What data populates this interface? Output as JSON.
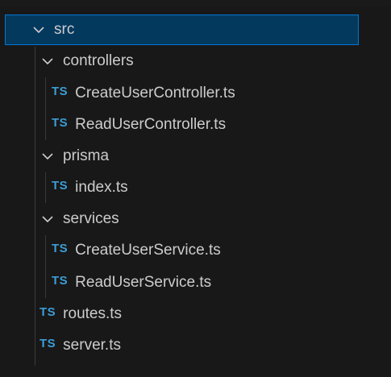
{
  "explorer": {
    "tree": [
      {
        "type": "folder",
        "label": "src",
        "depth": 0,
        "expanded": true,
        "selected": true,
        "icon": "chevron-down-icon"
      },
      {
        "type": "folder",
        "label": "controllers",
        "depth": 1,
        "expanded": true,
        "icon": "chevron-down-icon"
      },
      {
        "type": "file",
        "label": "CreateUserController.ts",
        "depth": 2,
        "badge": "TS"
      },
      {
        "type": "file",
        "label": "ReadUserController.ts",
        "depth": 2,
        "badge": "TS"
      },
      {
        "type": "folder",
        "label": "prisma",
        "depth": 1,
        "expanded": true,
        "icon": "chevron-down-icon"
      },
      {
        "type": "file",
        "label": "index.ts",
        "depth": 2,
        "badge": "TS"
      },
      {
        "type": "folder",
        "label": "services",
        "depth": 1,
        "expanded": true,
        "icon": "chevron-down-icon"
      },
      {
        "type": "file",
        "label": "CreateUserService.ts",
        "depth": 2,
        "badge": "TS"
      },
      {
        "type": "file",
        "label": "ReadUserService.ts",
        "depth": 2,
        "badge": "TS"
      },
      {
        "type": "file",
        "label": "routes.ts",
        "depth": 1,
        "badge": "TS"
      },
      {
        "type": "file",
        "label": "server.ts",
        "depth": 1,
        "badge": "TS"
      }
    ]
  },
  "colors": {
    "background": "#181818",
    "selection_bg": "#04395e",
    "selection_border": "#0078d4",
    "text": "#cccccc",
    "ts_badge": "#3c9dd6"
  }
}
